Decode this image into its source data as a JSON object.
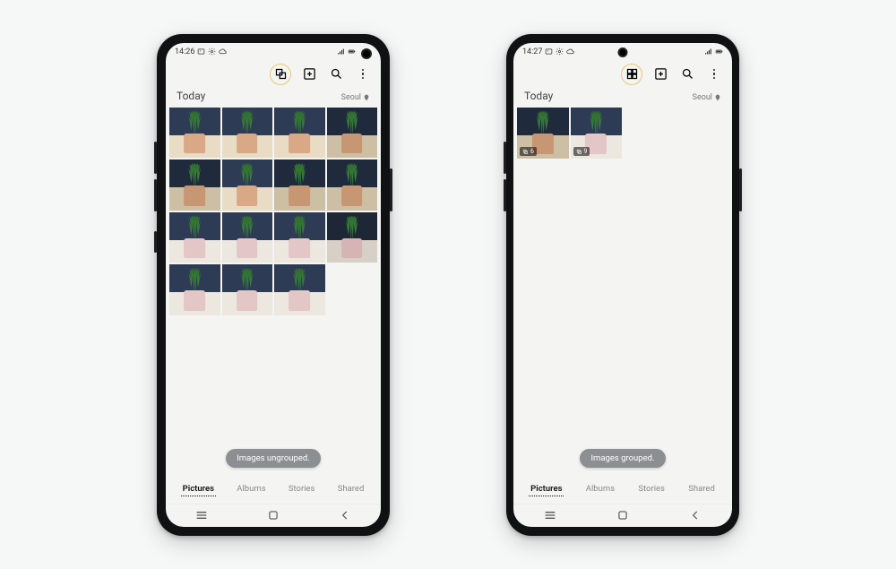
{
  "phoneA": {
    "status": {
      "time": "14:26"
    },
    "section": {
      "title": "Today",
      "location": "Seoul"
    },
    "toast": "Images ungrouped.",
    "tabs": [
      "Pictures",
      "Albums",
      "Stories",
      "Shared"
    ],
    "active_tab": 0,
    "thumbnails": [
      {
        "palette": "p-nw"
      },
      {
        "palette": "p-nw"
      },
      {
        "palette": "p-nw"
      },
      {
        "palette": "p-nd"
      },
      {
        "palette": "p-nd"
      },
      {
        "palette": "p-nw"
      },
      {
        "palette": "p-nd"
      },
      {
        "palette": "p-nd"
      },
      {
        "palette": "p-pw"
      },
      {
        "palette": "p-pw"
      },
      {
        "palette": "p-pw"
      },
      {
        "palette": "p-pd"
      },
      {
        "palette": "p-pw"
      },
      {
        "palette": "p-pw"
      },
      {
        "palette": "p-pw"
      }
    ]
  },
  "phoneB": {
    "status": {
      "time": "14:27"
    },
    "section": {
      "title": "Today",
      "location": "Seoul"
    },
    "toast": "Images grouped.",
    "tabs": [
      "Pictures",
      "Albums",
      "Stories",
      "Shared"
    ],
    "active_tab": 0,
    "thumbnails": [
      {
        "palette": "p-nd",
        "badge_count": "6"
      },
      {
        "palette": "p-pw",
        "badge_count": "9"
      }
    ]
  }
}
